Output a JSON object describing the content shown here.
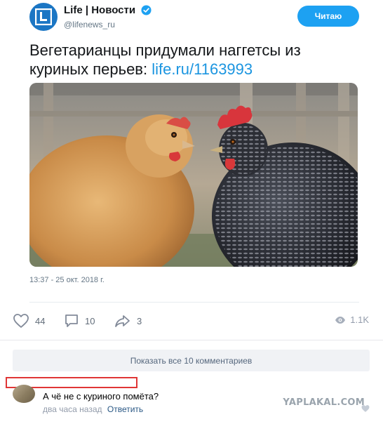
{
  "account": {
    "display_name": "Life | Новости",
    "handle": "@lifenews_ru",
    "follow_label": "Читаю"
  },
  "tweet": {
    "text": "Вегетарианцы придумали наггетсы из куриных перьев: ",
    "link": "life.ru/1163993",
    "timestamp": "13:37 - 25 окт. 2018 г."
  },
  "actions": {
    "likes": "44",
    "comments": "10",
    "shares": "3",
    "views": "1.1K"
  },
  "show_comments_label": "Показать все 10 комментариев",
  "comment": {
    "text": "А чё не с куриного помёта?",
    "time": "два часа назад",
    "reply_label": "Ответить"
  },
  "watermark": "YAPLAKAL.COM",
  "colors": {
    "accent": "#1da1f2",
    "link": "#1b95e0",
    "avatar_bg": "#1b76c4",
    "highlight_box": "#e03636"
  }
}
